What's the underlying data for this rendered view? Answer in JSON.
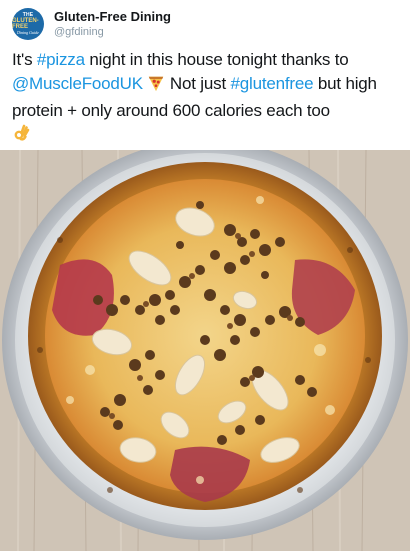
{
  "account": {
    "display_name": "Gluten-Free Dining",
    "handle": "@gfdining",
    "logo_text_top": "THE",
    "logo_text_mid": "GLUTEN-FREE",
    "logo_text_bottom": "Dining Guide"
  },
  "tweet": {
    "text_1": "It's ",
    "hashtag_pizza": "#pizza",
    "text_2": " night in this house tonight thanks to ",
    "mention": "@MuscleFoodUK",
    "text_3": " Not just ",
    "hashtag_glutenfree": "#glutenfree",
    "text_4": " but high protein + only around 600 calories each too"
  },
  "photo": {
    "icon": "pizza-photo",
    "table": "light wooden table",
    "tray": "silver pizza tray"
  },
  "colors": {
    "link": "#1b95e0",
    "handle": "#8899a6",
    "text": "#14171a",
    "avatar_bg": "#1d6aa8"
  }
}
